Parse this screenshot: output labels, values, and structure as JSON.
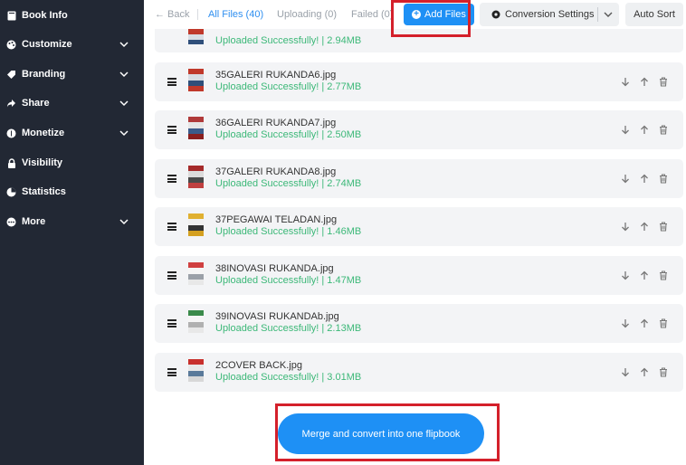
{
  "sidebar": {
    "items": [
      {
        "label": "Book Info",
        "icon": "book-icon",
        "has_chevron": false
      },
      {
        "label": "Customize",
        "icon": "palette-icon",
        "has_chevron": true
      },
      {
        "label": "Branding",
        "icon": "tag-icon",
        "has_chevron": true
      },
      {
        "label": "Share",
        "icon": "share-icon",
        "has_chevron": true
      },
      {
        "label": "Monetize",
        "icon": "coin-icon",
        "has_chevron": true
      },
      {
        "label": "Visibility",
        "icon": "lock-icon",
        "has_chevron": false
      },
      {
        "label": "Statistics",
        "icon": "chart-icon",
        "has_chevron": false
      },
      {
        "label": "More",
        "icon": "more-icon",
        "has_chevron": true
      }
    ]
  },
  "topbar": {
    "back": "← Back",
    "all_files": "All Files (40)",
    "uploading": "Uploading (0)",
    "failed": "Failed (0)",
    "add_files": "Add Files",
    "conversion_settings": "Conversion Settings",
    "auto_sort": "Auto Sort"
  },
  "partial_row": {
    "status": "Uploaded Successfully! | 2.94MB"
  },
  "files": [
    {
      "name": "35GALERI RUKANDA6.jpg",
      "status": "Uploaded Successfully! | 2.77MB"
    },
    {
      "name": "36GALERI RUKANDA7.jpg",
      "status": "Uploaded Successfully! | 2.50MB"
    },
    {
      "name": "37GALERI RUKANDA8.jpg",
      "status": "Uploaded Successfully! | 2.74MB"
    },
    {
      "name": "37PEGAWAI TELADAN.jpg",
      "status": "Uploaded Successfully! | 1.46MB"
    },
    {
      "name": "38INOVASI RUKANDA.jpg",
      "status": "Uploaded Successfully! | 1.47MB"
    },
    {
      "name": "39INOVASI RUKANDAb.jpg",
      "status": "Uploaded Successfully! | 2.13MB"
    },
    {
      "name": "2COVER BACK.jpg",
      "status": "Uploaded Successfully! | 3.01MB"
    }
  ],
  "merge_button": "Merge and convert into one flipbook",
  "colors": {
    "sidebar": "#222834",
    "accent": "#1e90f5",
    "success": "#3cb878",
    "highlight": "#d4202b"
  }
}
